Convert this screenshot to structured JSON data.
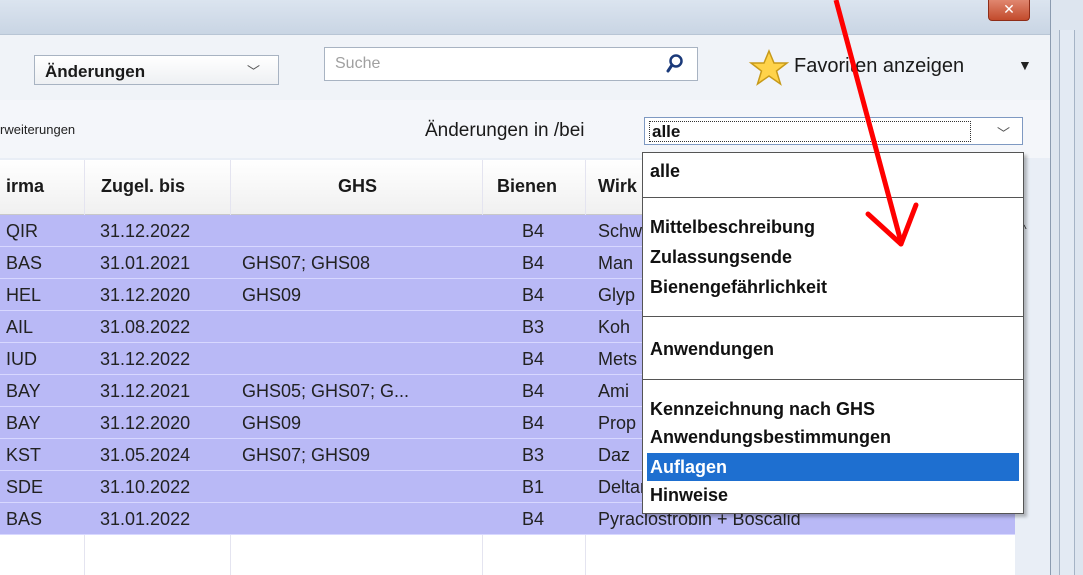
{
  "window": {
    "close_label": "✕"
  },
  "toolbar": {
    "mode_select_value": "Änderungen",
    "search_placeholder": "Suche",
    "favorites_label": "Favoriten anzeigen"
  },
  "filter": {
    "extensions_label": "rweiterungen",
    "changes_label": "Änderungen in /bei",
    "changes_value": "alle"
  },
  "table": {
    "columns": [
      "irma",
      "Zugel. bis",
      "GHS",
      "Bienen",
      "Wirk"
    ],
    "rows": [
      {
        "firma": "QIR",
        "zugel": "31.12.2022",
        "ghs": "",
        "bienen": "B4",
        "wirk": "Schw"
      },
      {
        "firma": "BAS",
        "zugel": "31.01.2021",
        "ghs": "GHS07; GHS08",
        "bienen": "B4",
        "wirk": "Man"
      },
      {
        "firma": "HEL",
        "zugel": "31.12.2020",
        "ghs": "GHS09",
        "bienen": "B4",
        "wirk": "Glyp"
      },
      {
        "firma": "AIL",
        "zugel": "31.08.2022",
        "ghs": "",
        "bienen": "B3",
        "wirk": "Koh"
      },
      {
        "firma": "IUD",
        "zugel": "31.12.2022",
        "ghs": "",
        "bienen": "B4",
        "wirk": "Mets"
      },
      {
        "firma": "BAY",
        "zugel": "31.12.2021",
        "ghs": "GHS05; GHS07; G...",
        "bienen": "B4",
        "wirk": "Ami"
      },
      {
        "firma": "BAY",
        "zugel": "31.12.2020",
        "ghs": "GHS09",
        "bienen": "B4",
        "wirk": "Prop"
      },
      {
        "firma": "KST",
        "zugel": "31.05.2024",
        "ghs": "GHS07; GHS09",
        "bienen": "B3",
        "wirk": "Daz"
      },
      {
        "firma": "SDE",
        "zugel": "31.10.2022",
        "ghs": "",
        "bienen": "B1",
        "wirk": "Deltamethrin"
      },
      {
        "firma": "BAS",
        "zugel": "31.01.2022",
        "ghs": "",
        "bienen": "B4",
        "wirk": "Pyraclostrobin + Boscalid"
      }
    ]
  },
  "dropdown": {
    "items": [
      {
        "label": "alle",
        "selected": false
      },
      {
        "label": "Mittelbeschreibung",
        "selected": false
      },
      {
        "label": "Zulassungsende",
        "selected": false
      },
      {
        "label": "Bienengefährlichkeit",
        "selected": false
      },
      {
        "label": "Anwendungen",
        "selected": false
      },
      {
        "label": "Kennzeichnung nach GHS",
        "selected": false
      },
      {
        "label": "Anwendungsbestimmungen",
        "selected": false
      },
      {
        "label": "Auflagen",
        "selected": true
      },
      {
        "label": "Hinweise",
        "selected": false
      }
    ]
  },
  "colors": {
    "row_highlight": "#b9b9f6",
    "dropdown_selected": "#1e6fd0",
    "annotation_arrow": "#ff0000"
  }
}
